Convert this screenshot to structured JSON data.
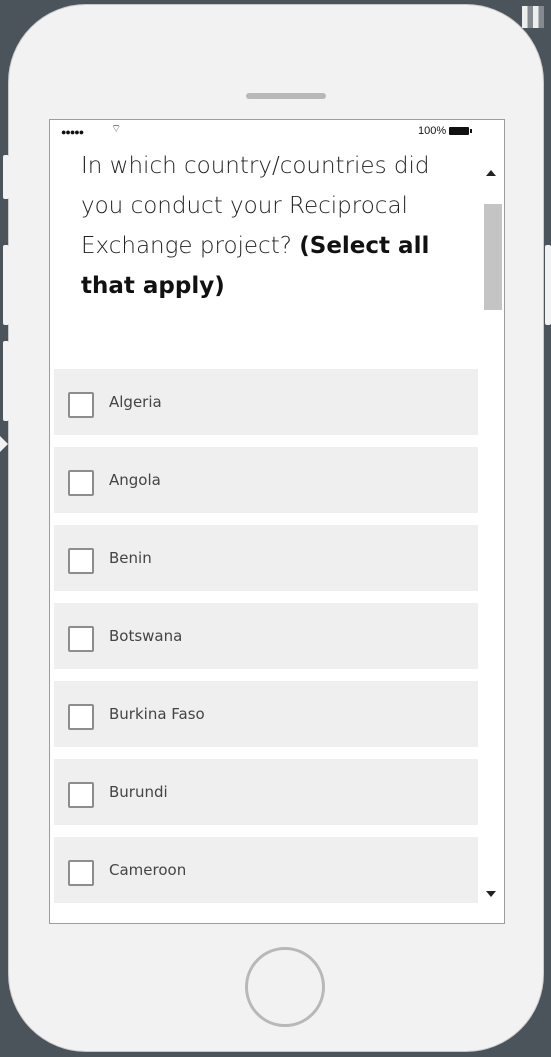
{
  "status_bar": {
    "signal": "●●●●●",
    "wifi_icon": "wifi-icon",
    "battery_percent": "100%",
    "battery_icon": "battery-icon"
  },
  "question": {
    "text_prefix": "In which country/countries did you conduct your Reciprocal Exchange project? ",
    "instruction": "(Select all that apply)"
  },
  "options": [
    {
      "label": "Algeria",
      "checked": false
    },
    {
      "label": "Angola",
      "checked": false
    },
    {
      "label": "Benin",
      "checked": false
    },
    {
      "label": "Botswana",
      "checked": false
    },
    {
      "label": "Burkina Faso",
      "checked": false
    },
    {
      "label": "Burundi",
      "checked": false
    },
    {
      "label": "Cameroon",
      "checked": false
    }
  ],
  "colors": {
    "background": "#4b535b",
    "phone_body": "#f2f2f2",
    "option_background": "#efefef",
    "scroll_thumb": "#c4c4c4"
  }
}
